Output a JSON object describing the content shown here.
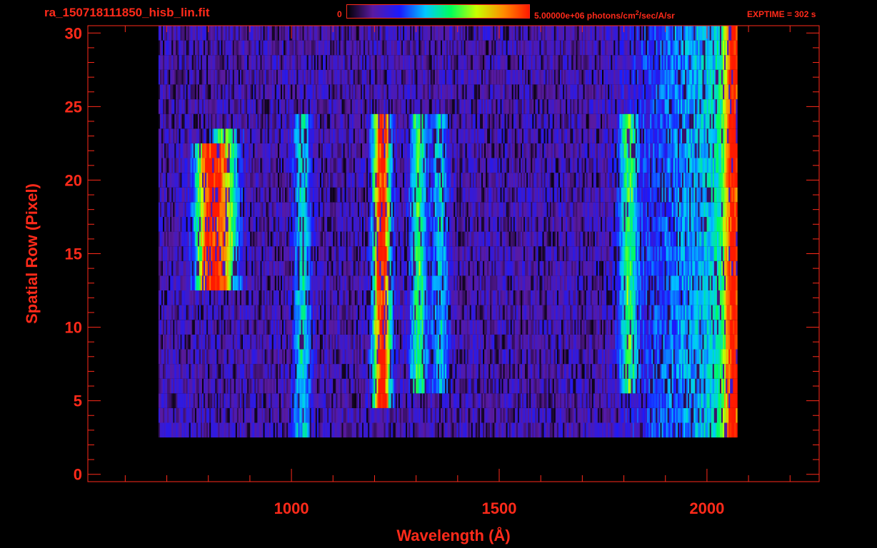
{
  "header": {
    "filename": "ra_150718111850_hisb_lin.fit",
    "colorbar_min_label": "0",
    "colorbar_max_label": "5.00000e+06 photons/cm",
    "colorbar_units_sup": "2",
    "colorbar_units_rest": "/sec/A/sr",
    "exptime_label": "EXPTIME = 302 s"
  },
  "colors": {
    "axis": "#ff2a1a",
    "colormap": [
      "#000000",
      "#5a1aa0",
      "#1a1aff",
      "#00c8ff",
      "#00ff5a",
      "#c8ff00",
      "#ff8c00",
      "#ff1a00"
    ]
  },
  "chart_data": {
    "type": "heatmap",
    "title": "ra_150718111850_hisb_lin.fit",
    "xlabel": "Wavelength (Å)",
    "ylabel": "Spatial Row (Pixel)",
    "xlim": [
      510,
      2270
    ],
    "ylim": [
      -0.5,
      30.5
    ],
    "x_ticks": [
      1000,
      1500,
      2000
    ],
    "x_tick_labels": [
      "1000",
      "1500",
      "2000"
    ],
    "y_ticks": [
      0,
      5,
      10,
      15,
      20,
      25,
      30
    ],
    "y_tick_labels": [
      "0",
      "5",
      "10",
      "15",
      "20",
      "25",
      "30"
    ],
    "colorbar_range": [
      0,
      5000000
    ],
    "colorbar_unit": "photons/cm2/sec/A/sr",
    "exposure_time_s": 302,
    "data_extent": {
      "wavelength": [
        680,
        2070
      ],
      "row": [
        3,
        30
      ]
    },
    "emission_features": [
      {
        "center": 800,
        "rows": [
          13,
          22
        ],
        "intensity": 0.85
      },
      {
        "center": 840,
        "rows": [
          13,
          23
        ],
        "intensity": 0.55
      },
      {
        "center": 1025,
        "rows": [
          3,
          24
        ],
        "intensity": 0.35
      },
      {
        "center": 1216,
        "rows": [
          5,
          24
        ],
        "intensity": 1.0
      },
      {
        "center": 1304,
        "rows": [
          6,
          24
        ],
        "intensity": 0.45
      },
      {
        "center": 1356,
        "rows": [
          6,
          24
        ],
        "intensity": 0.3
      },
      {
        "center": 1810,
        "rows": [
          6,
          24
        ],
        "intensity": 0.4
      },
      {
        "center": 2060,
        "rows": [
          2,
          30
        ],
        "intensity": 0.6
      }
    ],
    "grid": false
  }
}
